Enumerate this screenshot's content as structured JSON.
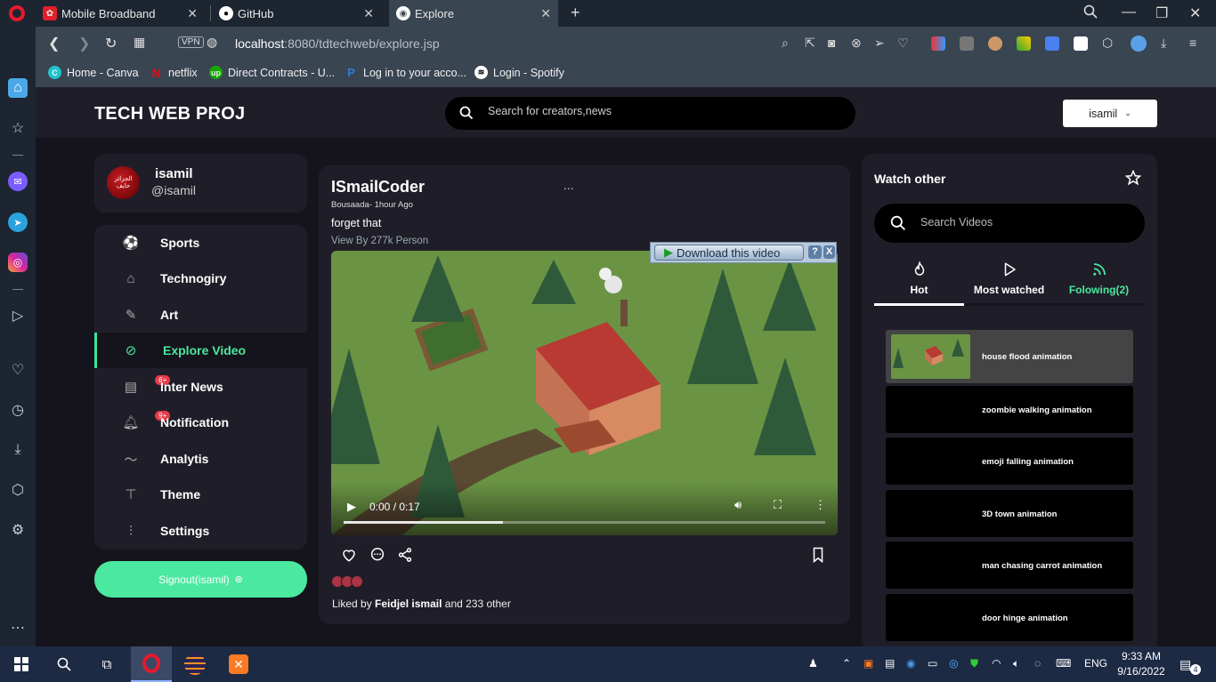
{
  "browser": {
    "tabs": [
      {
        "title": "Mobile Broadband"
      },
      {
        "title": "GitHub"
      },
      {
        "title": "Explore"
      }
    ],
    "vpn_label": "VPN",
    "url_host": "localhost",
    "url_path": ":8080/tdtechweb/explore.jsp",
    "bookmarks": [
      {
        "label": "Home - Canva"
      },
      {
        "label": "netflix"
      },
      {
        "label": "Direct Contracts - U..."
      },
      {
        "label": "Log in to your acco..."
      },
      {
        "label": "Login - Spotify"
      }
    ]
  },
  "header": {
    "brand": "TECH WEB PROJ",
    "search_placeholder": "Search for creators,news",
    "user_button": "isamil"
  },
  "profile": {
    "avatar_text": "الجزائر حايف",
    "name": "isamil",
    "handle": "@isamil"
  },
  "menu": {
    "items": [
      {
        "label": "Sports",
        "icon": "soccer-ball-icon"
      },
      {
        "label": "Technogiry",
        "icon": "robot-icon"
      },
      {
        "label": "Art",
        "icon": "palette-icon"
      },
      {
        "label": "Explore Video",
        "icon": "compass-icon",
        "active": true
      },
      {
        "label": "Inter News",
        "icon": "news-icon",
        "badge": "6+"
      },
      {
        "label": "Notification",
        "icon": "bell-icon",
        "badge": "9+"
      },
      {
        "label": "Analytis",
        "icon": "trend-line-icon"
      },
      {
        "label": "Theme",
        "icon": "paint-roller-icon"
      },
      {
        "label": "Settings",
        "icon": "sliders-icon"
      }
    ]
  },
  "signout": {
    "label": "Signout(isamil)"
  },
  "post": {
    "author": "ISmailCoder",
    "menu": "...",
    "meta": "Bousaada- 1hour Ago",
    "caption": "forget that",
    "views": "View By 277k Person",
    "video": {
      "time": "0:00 / 0:17",
      "progress": 0.33
    },
    "download_label": "Download this video",
    "download_help": "?",
    "download_close": "X",
    "liked_by_prefix": "Liked by",
    "liked_by_name": "Feidjel ismail",
    "liked_by_suffix": "and 233 other"
  },
  "watch": {
    "title": "Watch other",
    "search_placeholder": "Search Videos",
    "tabs": [
      {
        "label": "Hot",
        "icon": "fire-icon",
        "active": true
      },
      {
        "label": "Most watched",
        "icon": "play-icon"
      },
      {
        "label": "Folowing(2)",
        "icon": "rss-icon"
      }
    ],
    "videos": [
      {
        "title": "house flood animation",
        "selected": true
      },
      {
        "title": "zoombie walking animation"
      },
      {
        "title": "emoji falling animation"
      },
      {
        "title": "3D town animation"
      },
      {
        "title": "man chasing carrot animation"
      },
      {
        "title": "door hinge animation"
      }
    ]
  },
  "taskbar": {
    "lang": "ENG",
    "time": "9:33 AM",
    "date": "9/16/2022",
    "notif_count": "4"
  },
  "colors": {
    "accent": "#4be89f",
    "badge": "#e53a49",
    "panel": "#1f1e28",
    "bg": "#15141c"
  }
}
